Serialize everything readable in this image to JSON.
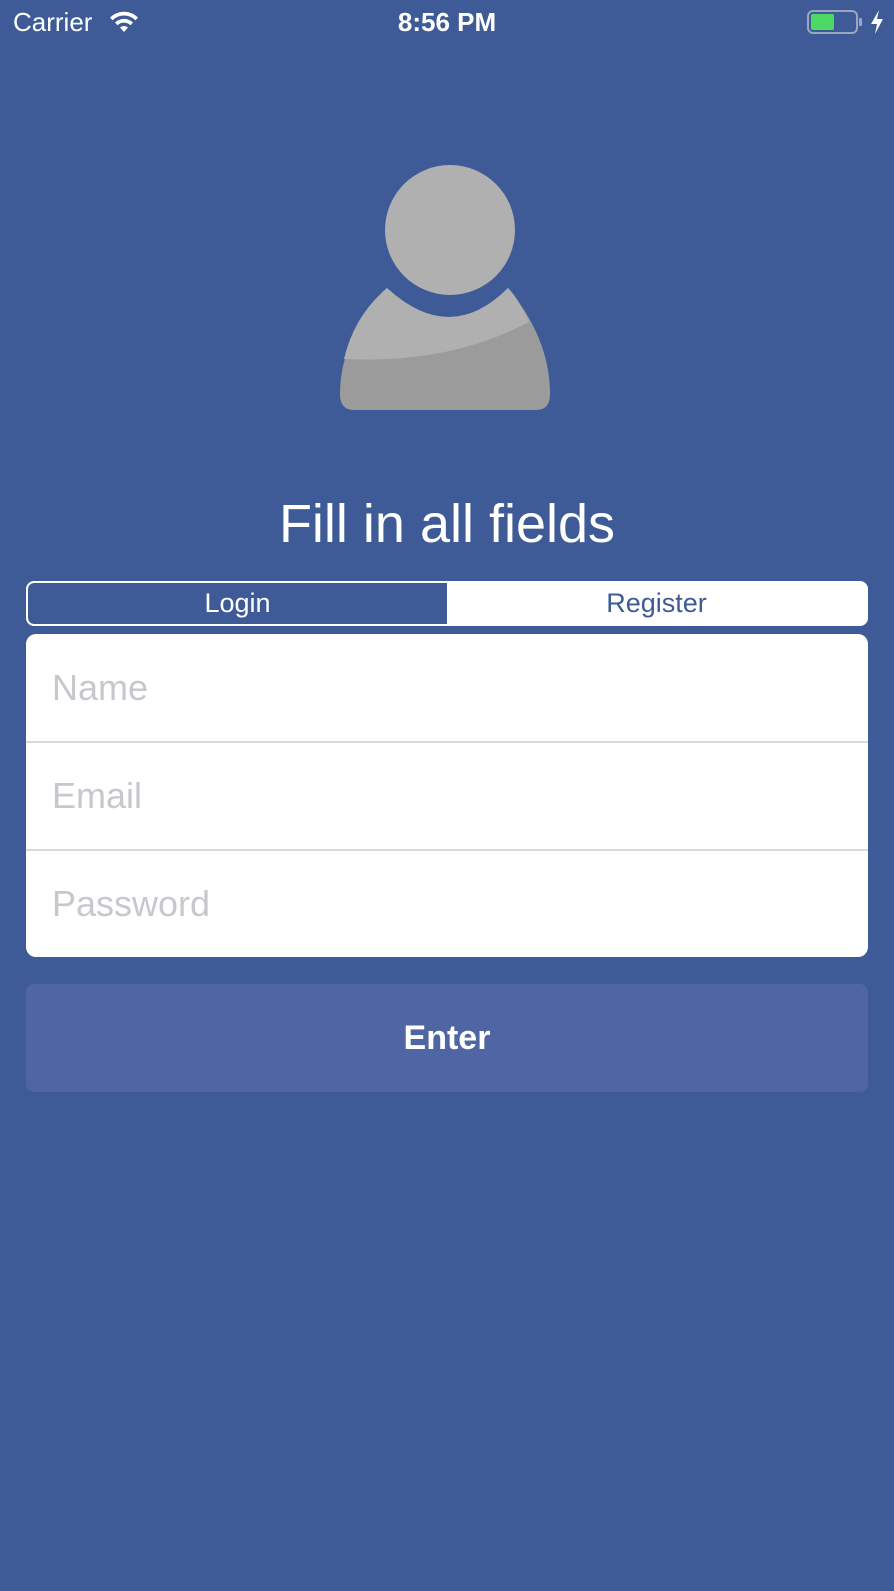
{
  "status_bar": {
    "carrier": "Carrier",
    "time": "8:56 PM",
    "battery_color": "#4cd964"
  },
  "avatar": {
    "icon": "person-placeholder-icon",
    "color": "#b0b0b0"
  },
  "title": "Fill in all fields",
  "segmented_control": {
    "segments": [
      {
        "label": "Login",
        "selected": true
      },
      {
        "label": "Register",
        "selected": false
      }
    ]
  },
  "form": {
    "name": {
      "placeholder": "Name",
      "value": ""
    },
    "email": {
      "placeholder": "Email",
      "value": ""
    },
    "password": {
      "placeholder": "Password",
      "value": ""
    }
  },
  "enter_button": {
    "label": "Enter"
  },
  "colors": {
    "background": "#3e5b97",
    "button": "#5065a3",
    "placeholder": "#c7c7cd"
  }
}
